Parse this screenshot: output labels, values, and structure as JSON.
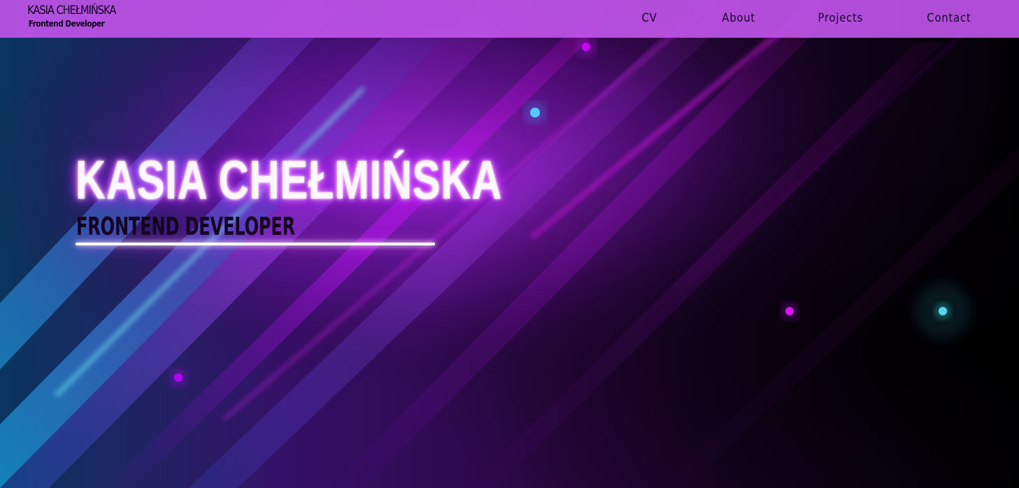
{
  "navbar": {
    "brand_name": "KASIA CHEŁMIŃSKA",
    "brand_role": "Frontend Developer",
    "links": [
      {
        "label": "CV"
      },
      {
        "label": "About"
      },
      {
        "label": "Projects"
      },
      {
        "label": "Contact"
      }
    ]
  },
  "hero": {
    "title": "KASIA CHEŁMIŃSKA",
    "subtitle": "FRONTEND DEVELOPER"
  },
  "colors": {
    "navbar_background": "#bf54e8",
    "background_dark": "#050109",
    "accent_purple": "#c400ff",
    "accent_cyan": "#25d7ff",
    "title_glow": "#d54cff"
  }
}
